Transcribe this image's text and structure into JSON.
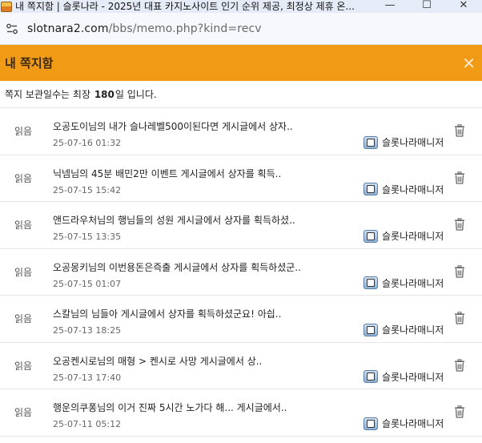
{
  "window": {
    "title": "내 쪽지함 | 슬롯나라 - 2025년 대표 카지노사이트 인기 순위 제공, 최정상 제휴 온...",
    "minimize": "—",
    "maximize": "☐",
    "close": "✕"
  },
  "address": {
    "host": "slotnara2.com",
    "path": "/bbs/memo.php?kind=recv"
  },
  "header": {
    "title": "내 쪽지함",
    "close_label": "✕"
  },
  "notice": {
    "prefix": "쪽지 보관일수는 최장",
    "days": "180",
    "suffix": "일 입니다."
  },
  "messages": [
    {
      "status": "읽음",
      "subject": "오공도이님의 내가 슬나레벨500이된다면 게시글에서 상자..",
      "date": "25-07-16 01:32",
      "sender": "슬롯나라매니저"
    },
    {
      "status": "읽음",
      "subject": "닉넴님의 45분 배민2만 이벤트 게시글에서 상자를 획득..",
      "date": "25-07-15 15:42",
      "sender": "슬롯나라매니저"
    },
    {
      "status": "읽음",
      "subject": "앤드라우처님의 행님들의 성원 게시글에서 상자를 획득하셨..",
      "date": "25-07-15 13:35",
      "sender": "슬롯나라매니저"
    },
    {
      "status": "읽음",
      "subject": "오공몽키님의 이번용돈은즉출 게시글에서 상자를 획득하셨군..",
      "date": "25-07-15 01:07",
      "sender": "슬롯나라매니저"
    },
    {
      "status": "읽음",
      "subject": "스칼님의 님들아 게시글에서 상자를 획득하셨군요! 아싑..",
      "date": "25-07-13 18:25",
      "sender": "슬롯나라매니저"
    },
    {
      "status": "읽음",
      "subject": "오공켄시로님의 매형 > 켄시로 사망 게시글에서 상..",
      "date": "25-07-13 17:40",
      "sender": "슬롯나라매니저"
    },
    {
      "status": "읽음",
      "subject": "행운의쿠퐁님의 이거 진짜 5시간 노가다 해... 게시글에서..",
      "date": "25-07-11 05:12",
      "sender": "슬롯나라매니저"
    }
  ]
}
